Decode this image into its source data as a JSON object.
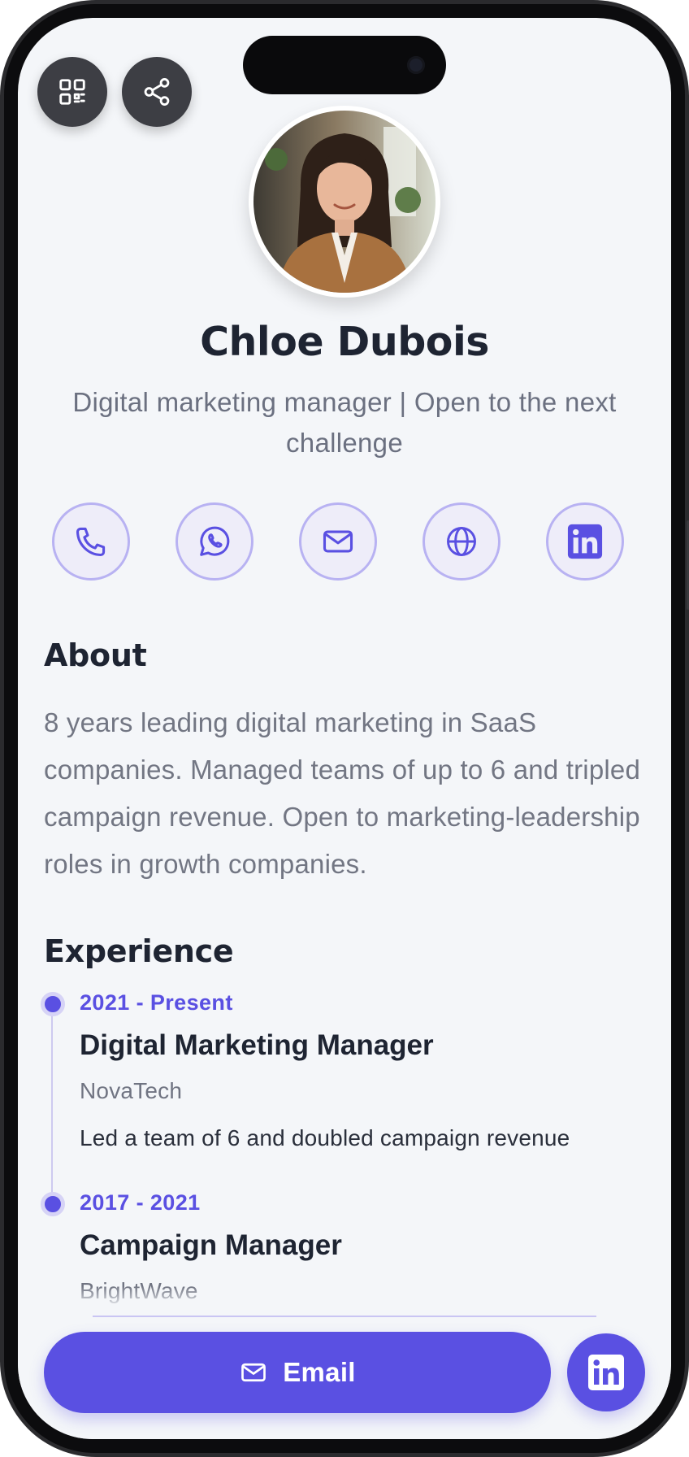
{
  "profile": {
    "name": "Chloe Dubois",
    "tagline": "Digital marketing manager | Open to the next challenge"
  },
  "top_actions": [
    {
      "icon": "qr-code-icon"
    },
    {
      "icon": "share-icon"
    }
  ],
  "contacts": [
    {
      "icon": "phone-icon"
    },
    {
      "icon": "whatsapp-icon"
    },
    {
      "icon": "mail-icon"
    },
    {
      "icon": "globe-icon"
    },
    {
      "icon": "linkedin-icon"
    }
  ],
  "about": {
    "title": "About",
    "text": "8 years leading digital marketing in SaaS companies. Managed teams of up to 6 and tripled campaign revenue. Open to marketing-leadership roles in growth companies."
  },
  "experience": {
    "title": "Experience",
    "items": [
      {
        "period": "2021 - Present",
        "role": "Digital Marketing Manager",
        "company": "NovaTech",
        "description": "Led a team of 6 and doubled campaign revenue"
      },
      {
        "period": "2017 - 2021",
        "role": "Campaign Manager",
        "company": "BrightWave"
      }
    ]
  },
  "footer": {
    "email_label": "Email"
  },
  "colors": {
    "accent": "#5a50e2",
    "accent_light": "#b8b2f2",
    "background": "#f4f6f9",
    "text_dark": "#1e2432",
    "text_muted": "#727683"
  }
}
